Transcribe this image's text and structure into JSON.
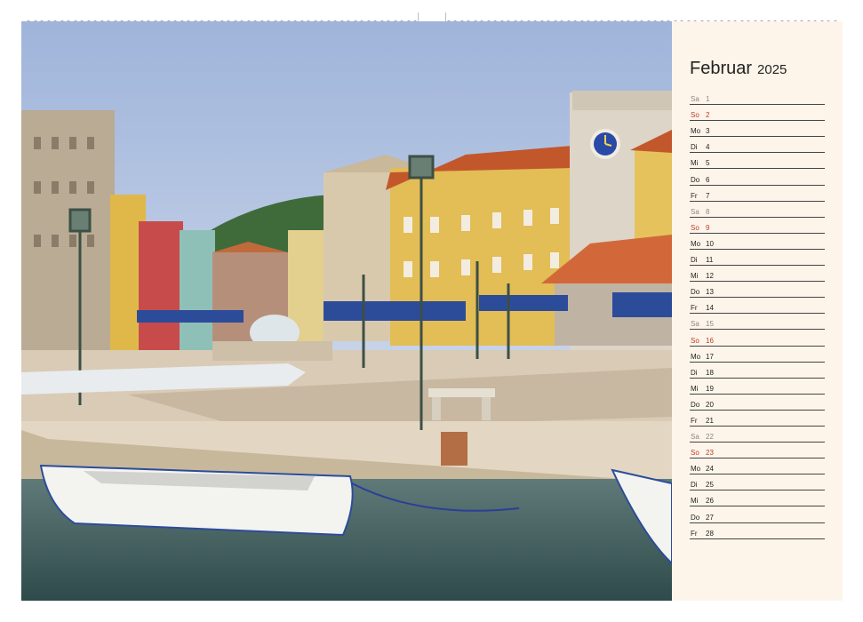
{
  "calendar": {
    "month": "Februar",
    "year": "2025",
    "days": [
      {
        "wd": "Sa",
        "d": "1",
        "type": "sat"
      },
      {
        "wd": "So",
        "d": "2",
        "type": "sun"
      },
      {
        "wd": "Mo",
        "d": "3",
        "type": "work"
      },
      {
        "wd": "Di",
        "d": "4",
        "type": "work"
      },
      {
        "wd": "Mi",
        "d": "5",
        "type": "work"
      },
      {
        "wd": "Do",
        "d": "6",
        "type": "work"
      },
      {
        "wd": "Fr",
        "d": "7",
        "type": "work"
      },
      {
        "wd": "Sa",
        "d": "8",
        "type": "sat"
      },
      {
        "wd": "So",
        "d": "9",
        "type": "sun"
      },
      {
        "wd": "Mo",
        "d": "10",
        "type": "work"
      },
      {
        "wd": "Di",
        "d": "11",
        "type": "work"
      },
      {
        "wd": "Mi",
        "d": "12",
        "type": "work"
      },
      {
        "wd": "Do",
        "d": "13",
        "type": "work"
      },
      {
        "wd": "Fr",
        "d": "14",
        "type": "work"
      },
      {
        "wd": "Sa",
        "d": "15",
        "type": "sat"
      },
      {
        "wd": "So",
        "d": "16",
        "type": "sun"
      },
      {
        "wd": "Mo",
        "d": "17",
        "type": "work"
      },
      {
        "wd": "Di",
        "d": "18",
        "type": "work"
      },
      {
        "wd": "Mi",
        "d": "19",
        "type": "work"
      },
      {
        "wd": "Do",
        "d": "20",
        "type": "work"
      },
      {
        "wd": "Fr",
        "d": "21",
        "type": "work"
      },
      {
        "wd": "Sa",
        "d": "22",
        "type": "sat"
      },
      {
        "wd": "So",
        "d": "23",
        "type": "sun"
      },
      {
        "wd": "Mo",
        "d": "24",
        "type": "work"
      },
      {
        "wd": "Di",
        "d": "25",
        "type": "work"
      },
      {
        "wd": "Mi",
        "d": "26",
        "type": "work"
      },
      {
        "wd": "Do",
        "d": "27",
        "type": "work"
      },
      {
        "wd": "Fr",
        "d": "28",
        "type": "work"
      }
    ]
  },
  "colors": {
    "panel_bg": "#fdf5ea",
    "sunday": "#c0392b",
    "saturday": "#888888",
    "rule": "#444444"
  },
  "photo": {
    "scene": "harbour-square-illustration"
  }
}
